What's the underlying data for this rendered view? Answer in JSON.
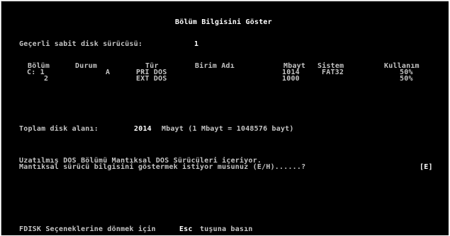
{
  "title": "Bölüm Bilgisini Göster",
  "current_drive": {
    "label": "Geçerli sabit disk sürücüsü:",
    "value": "1"
  },
  "table": {
    "headers": [
      "Bölüm",
      "Durum",
      "Tür",
      "Birim Adı",
      "Mbayt",
      "Sistem",
      "Kullanım"
    ],
    "rows": [
      {
        "partition": "C: 1",
        "status": "A",
        "type": "PRI DOS",
        "volume": "",
        "mbytes": "1014",
        "system": "FAT32",
        "usage": "50%"
      },
      {
        "partition": "2",
        "status": "",
        "type": "EXT DOS",
        "volume": "",
        "mbytes": "1000",
        "system": "",
        "usage": "50%"
      }
    ]
  },
  "total": {
    "label": "Toplam disk alanı:",
    "value": "2014",
    "suffix": "Mbayt (1 Mbayt = 1048576 bayt)"
  },
  "message": {
    "line1": "Uzatılmış DOS Bölümü Mantıksal DOS Sürücüleri içeriyor.",
    "line2": "Mantıksal sürücü bilgisini göstermek istiyor musunuz (E/H)......?",
    "answer": "[E]"
  },
  "footer": {
    "prefix": "FDISK Seçeneklerine dönmek için",
    "key": "Esc",
    "suffix": "tuşuna basın"
  }
}
